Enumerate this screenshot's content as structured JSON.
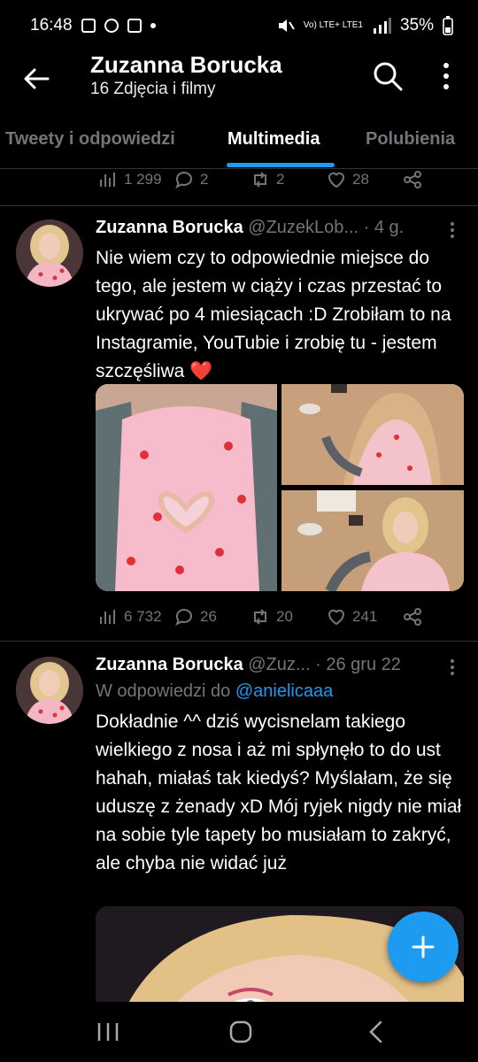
{
  "status_bar": {
    "time": "16:48",
    "network": "Vo) LTE+ LTE1",
    "battery": "35%"
  },
  "header": {
    "title": "Zuzanna Borucka",
    "subtitle": "16 Zdjęcia i filmy"
  },
  "tabs": [
    {
      "label": "Tweety i odpowiedzi",
      "active": false
    },
    {
      "label": "Multimedia",
      "active": true
    },
    {
      "label": "Polubienia",
      "active": false
    }
  ],
  "tweet0": {
    "views": "1 299",
    "replies": "2",
    "retweets": "2",
    "likes": "28"
  },
  "tweet1": {
    "name": "Zuzanna Borucka",
    "handle": "@ZuzekLob...",
    "time": "· 4 g.",
    "text": "Nie wiem czy to odpowiednie miejsce do tego, ale jestem w ciąży i czas przestać to ukrywać po 4 miesiącach :D Zrobiłam to na Instagramie, YouTubie i zrobię tu - jestem szczęśliwa",
    "emoji": "❤️",
    "views": "6 732",
    "replies": "26",
    "retweets": "20",
    "likes": "241"
  },
  "tweet2": {
    "name": "Zuzanna Borucka",
    "handle": "@Zuz...",
    "time": "· 26 gru 22",
    "reply_prefix": "W odpowiedzi do",
    "reply_user": "@anielicaaa",
    "text": "Dokładnie ^^ dziś wycisnelam takiego wielkiego z nosa i aż mi spłynęło to do ust hahah, miałaś tak kiedyś? Myślałam, że się uduszę z żenady xD Mój ryjek nigdy nie miał na sobie tyle tapety bo musiałam to zakryć, ale chyba nie widać już"
  },
  "colors": {
    "accent": "#1d9bf0",
    "muted": "#71767b",
    "background": "#000000"
  }
}
